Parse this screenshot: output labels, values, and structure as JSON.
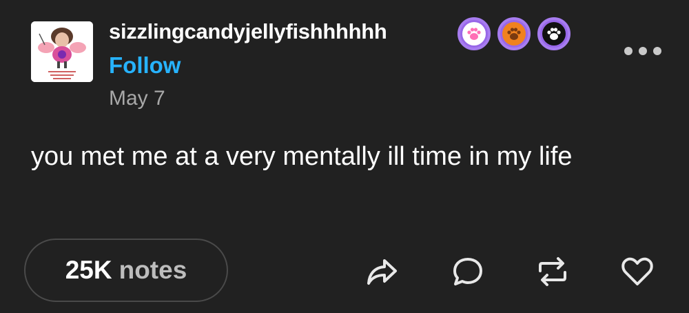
{
  "post": {
    "author": {
      "username": "sizzlingcandyjellyfishhhhhh",
      "follow_label": "Follow",
      "avatar_icon": "avatar-image",
      "badges": [
        {
          "icon": "pink-paw-badge-icon",
          "paw_color": "#ff6fb5",
          "inner_bg": "#ffffff"
        },
        {
          "icon": "orange-paw-badge-icon",
          "paw_color": "#7a3a10",
          "inner_bg": "#f0821e"
        },
        {
          "icon": "black-paw-badge-icon",
          "paw_color": "#ffffff",
          "inner_bg": "#111111"
        }
      ]
    },
    "date": "May 7",
    "body": "you met me at a very mentally ill time in my life",
    "notes": {
      "count": "25K",
      "label": "notes"
    }
  },
  "actions": [
    "share-icon",
    "reply-icon",
    "reblog-icon",
    "like-icon"
  ],
  "colors": {
    "background": "#212121",
    "link": "#27b3ff",
    "muted": "#a8a8a8",
    "badge_ring": "#9867e8"
  }
}
